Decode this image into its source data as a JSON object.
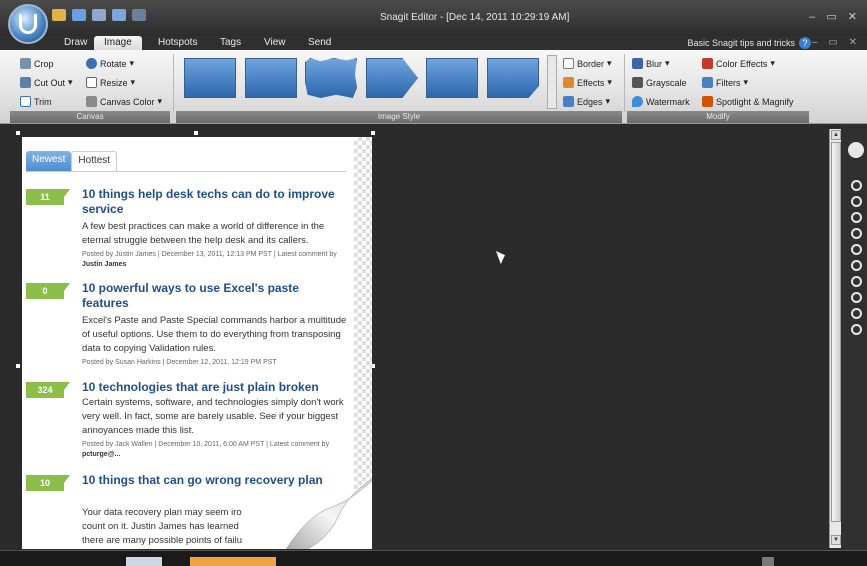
{
  "window": {
    "title": "Snagit Editor - [Dec 14, 2011 10:29:19 AM]",
    "controls": "– ▭ ✕"
  },
  "ribbon_tabs": [
    "Draw",
    "Image",
    "Hotspots",
    "Tags",
    "View",
    "Send"
  ],
  "active_tab": "Image",
  "help": {
    "link": "Basic Snagit tips and tricks",
    "icon": "?",
    "controls": "– ▭ ✕"
  },
  "ribbon": {
    "canvas_group": {
      "label": "Canvas",
      "crop": "Crop",
      "rotate": "Rotate",
      "cut_out": "Cut Out",
      "resize": "Resize",
      "trim": "Trim",
      "canvas_color": "Canvas Color"
    },
    "image_style_group": {
      "label": "Image Style",
      "border": "Border",
      "effects": "Effects",
      "edges": "Edges"
    },
    "modify_group": {
      "label": "Modify",
      "blur": "Blur",
      "color_effects": "Color Effects",
      "grayscale": "Grayscale",
      "filters": "Filters",
      "watermark": "Watermark",
      "spotlight": "Spotlight & Magnify"
    }
  },
  "capture": {
    "tabs": [
      "Newest",
      "Hottest"
    ],
    "articles": [
      {
        "count": "11",
        "title": "10 things help desk techs can do to improve service",
        "body": "A few best practices can make a world of difference in the eternal struggle between the help desk and its callers.",
        "meta_prefix": "Posted by Justin James | December 13, 2011, 12:13 PM PST | Latest comment by",
        "meta_author": "Justin James"
      },
      {
        "count": "0",
        "title": "10 powerful ways to use Excel's paste features",
        "body": "Excel's Paste and Paste Special commands harbor a multitude of useful options. Use them to do everything from transposing data to copying Validation rules.",
        "meta_prefix": "Posted by Susan Harkins | December 12, 2011, 12:19 PM PST",
        "meta_author": ""
      },
      {
        "count": "324",
        "title": "10 technologies that are just plain broken",
        "body": "Certain systems, software, and technologies simply don't work very well. In fact, some are barely usable. See if your biggest annoyances made this list.",
        "meta_prefix": "Posted by Jack Wallen | December 10, 2011, 6:00 AM PST | Latest comment by",
        "meta_author": "pcturge@..."
      },
      {
        "count": "10",
        "title": "10 things that can go wrong recovery plan",
        "body": "Your data recovery plan may seem iro count on it. Justin James has learned there are many possible points of failu",
        "meta_prefix": "",
        "meta_author": ""
      }
    ]
  },
  "side_toolbar": {
    "search_icon": "magnifier-icon"
  },
  "colors": {
    "accent_blue": "#1f4e8e",
    "badge_green": "#8bbf4a",
    "tab_blue": "#4f8cd0"
  }
}
